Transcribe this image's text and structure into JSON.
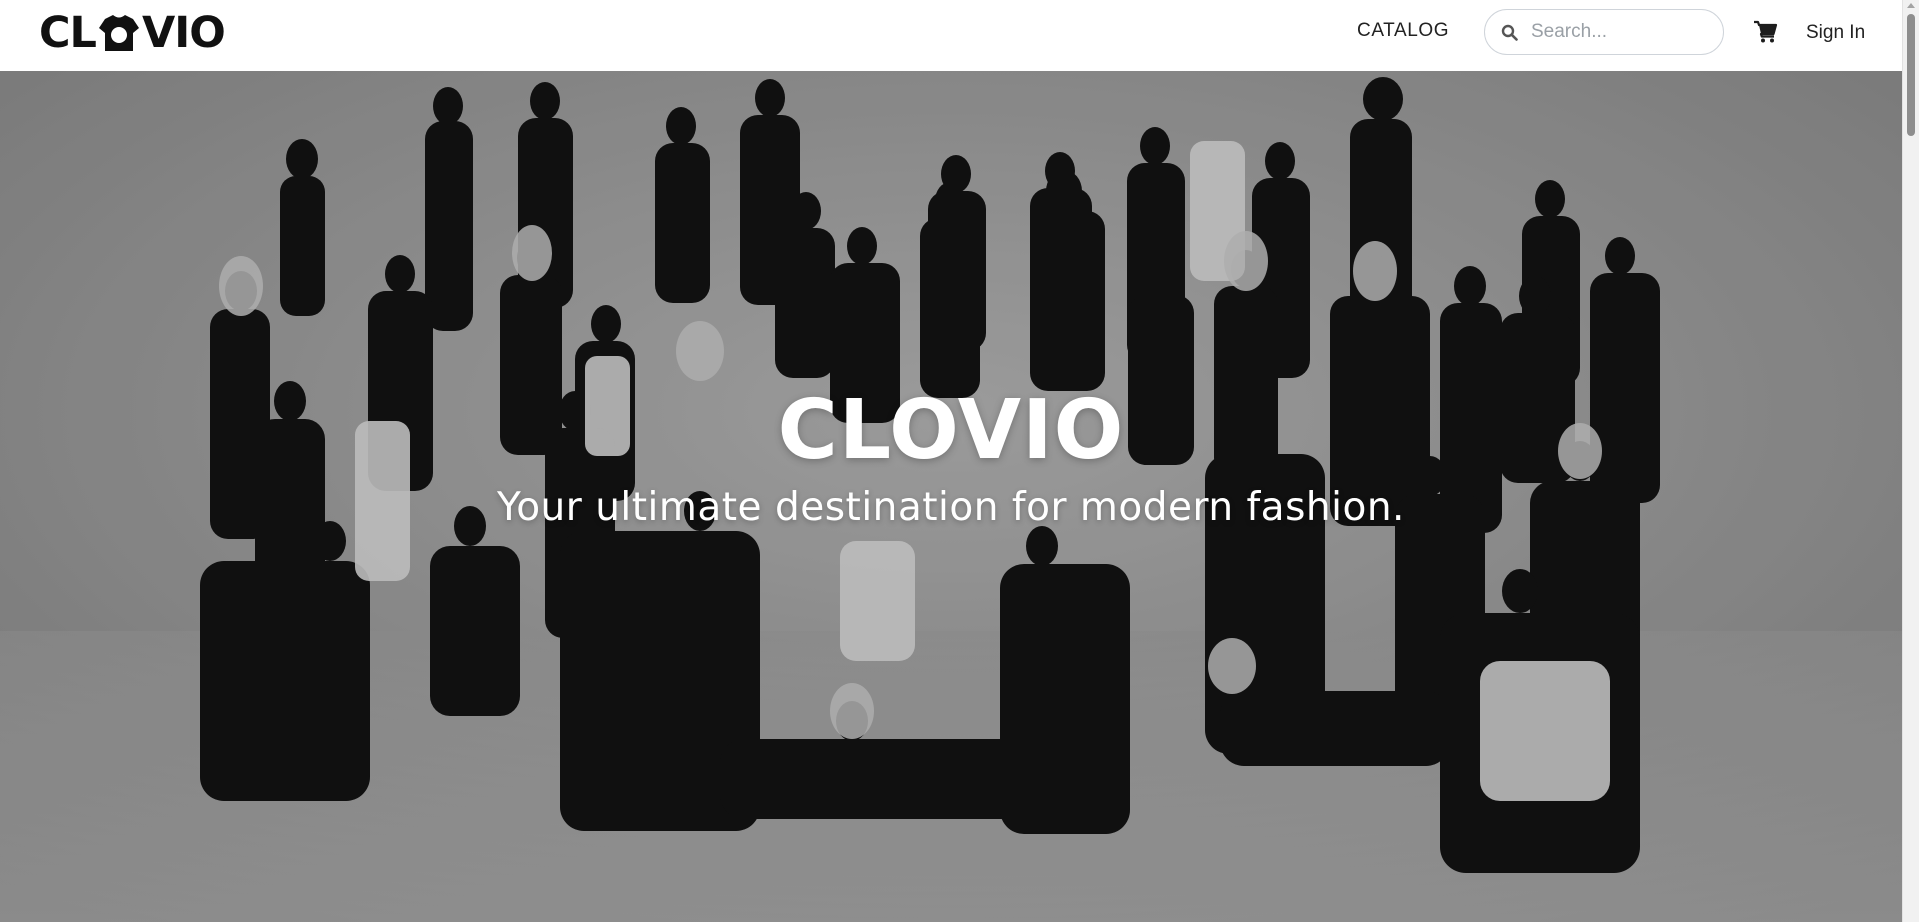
{
  "brand": {
    "logo_text_left": "CL",
    "logo_text_right": "VIO",
    "logo_mark_icon": "t-shirt-o-icon"
  },
  "nav": {
    "catalog_label": "CATALOG",
    "search_placeholder": "Search...",
    "search_value": "",
    "search_icon": "search-icon",
    "cart_icon": "shopping-cart-icon",
    "signin_label": "Sign In"
  },
  "hero": {
    "title": "CLOVIO",
    "subtitle": "Your ultimate destination for modern fashion.",
    "image_description": "black-and-white group photo of models"
  },
  "colors": {
    "header_bg": "#ffffff",
    "text_dark": "#222222",
    "hero_text": "#ffffff"
  }
}
